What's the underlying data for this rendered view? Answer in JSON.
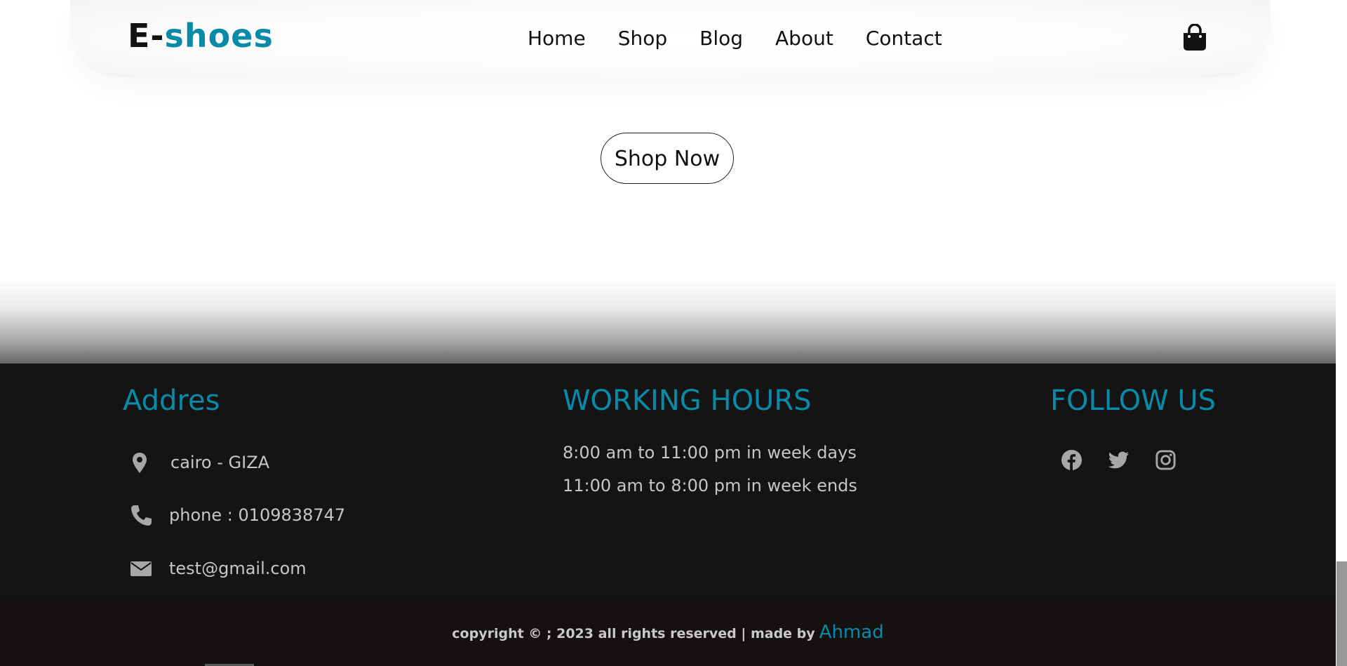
{
  "header": {
    "logo_prefix": "E-",
    "logo_accent": "shoes",
    "nav": [
      "Home",
      "Shop",
      "Blog",
      "About",
      "Contact"
    ],
    "cart_icon": "shopping-bag-icon"
  },
  "hero": {
    "cta_label": "Shop Now"
  },
  "footer": {
    "address_title": "Addres",
    "location_text": "cairo - GIZA",
    "phone_text": "phone : 0109838747",
    "email_text": "test@gmail.com",
    "hours_title": "WORKING HOURS",
    "hours": [
      "8:00 am to 11:00 pm in week days",
      "11:00 am to 8:00 pm in week ends"
    ],
    "follow_title": "FOLLOW US",
    "social_icons": [
      "facebook-icon",
      "twitter-icon",
      "instagram-icon"
    ]
  },
  "copyright": {
    "text": "copyright © ; 2023 all rights reserved | made by",
    "author": "Ahmad"
  },
  "colors": {
    "accent": "#088aa8",
    "footer_bg": "#141414",
    "copyright_bg": "#161111",
    "footer_text": "#c6c6c6"
  }
}
